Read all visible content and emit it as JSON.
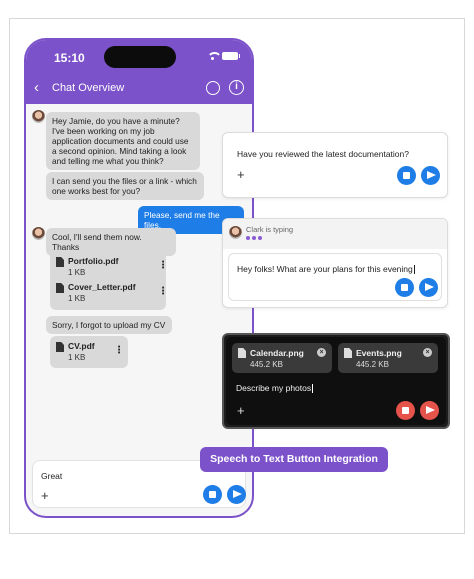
{
  "status": {
    "time": "15:10"
  },
  "header": {
    "title": "Chat Overview"
  },
  "messages": [
    {
      "from": "other",
      "text": "Hey Jamie, do you have a minute? I've been working on my job application documents and could use a second opinion. Mind taking a look and telling me what you think?"
    },
    {
      "from": "other",
      "text": "I can send you the files or a link - which one works best for you?"
    },
    {
      "from": "me",
      "text": "Please, send me the files."
    },
    {
      "from": "other",
      "text": "Cool, I'll send them now. Thanks"
    },
    {
      "from": "other",
      "text": "Sorry, I forgot to upload my CV"
    }
  ],
  "files": [
    {
      "name": "Portfolio.pdf",
      "size": "1 KB"
    },
    {
      "name": "Cover_Letter.pdf",
      "size": "1 KB"
    },
    {
      "name": "CV.pdf",
      "size": "1 KB"
    }
  ],
  "composer": {
    "text": "Great"
  },
  "card_question": {
    "text": "Have you reviewed the latest documentation?"
  },
  "card_typing": {
    "status": "Clark is typing",
    "text": "Hey folks! What are your plans for this evening"
  },
  "card_dark": {
    "attachments": [
      {
        "name": "Calendar.png",
        "size": "445.2 KB"
      },
      {
        "name": "Events.png",
        "size": "445.2 KB"
      }
    ],
    "text": "Describe my photos"
  },
  "feature_label": "Speech to Text Button Integration",
  "colors": {
    "accent": "#7b52c9",
    "primary": "#1e7de6",
    "danger": "#e5534b"
  }
}
